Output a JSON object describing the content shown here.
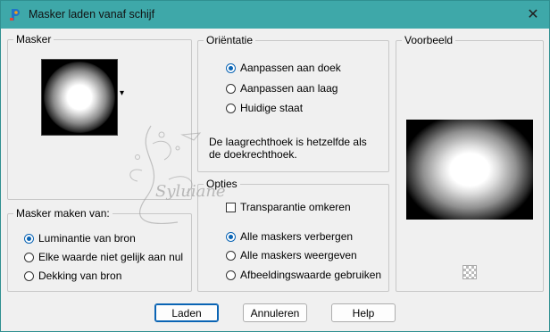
{
  "window": {
    "title": "Masker laden vanaf schijf",
    "close_glyph": "✕"
  },
  "mask_group": {
    "label": "Masker",
    "dropdown_glyph": "▾"
  },
  "mask_from_group": {
    "label": "Masker maken van:",
    "options": [
      {
        "label": "Luminantie van bron",
        "selected": true
      },
      {
        "label": "Elke waarde niet gelijk aan nul",
        "selected": false
      },
      {
        "label": "Dekking van bron",
        "selected": false
      }
    ]
  },
  "orientation_group": {
    "label": "Oriëntatie",
    "options": [
      {
        "label": "Aanpassen aan doek",
        "selected": true
      },
      {
        "label": "Aanpassen aan laag",
        "selected": false
      },
      {
        "label": "Huidige staat",
        "selected": false
      }
    ],
    "note_line1": "De laagrechthoek is hetzelfde als",
    "note_line2": "de doekrechthoek."
  },
  "options_group": {
    "label": "Opties",
    "invert_label": "Transparantie omkeren",
    "invert_checked": false,
    "options": [
      {
        "label": "Alle maskers verbergen",
        "selected": true
      },
      {
        "label": "Alle maskers weergeven",
        "selected": false
      },
      {
        "label": "Afbeeldingswaarde gebruiken",
        "selected": false
      }
    ]
  },
  "preview_group": {
    "label": "Voorbeeld"
  },
  "watermark_text": "Syluiane",
  "buttons": {
    "load": "Laden",
    "cancel": "Annuleren",
    "help": "Help"
  },
  "colors": {
    "titlebar": "#3ea8a9",
    "accent": "#0a64b4",
    "dialog_bg": "#f0f0f0"
  }
}
